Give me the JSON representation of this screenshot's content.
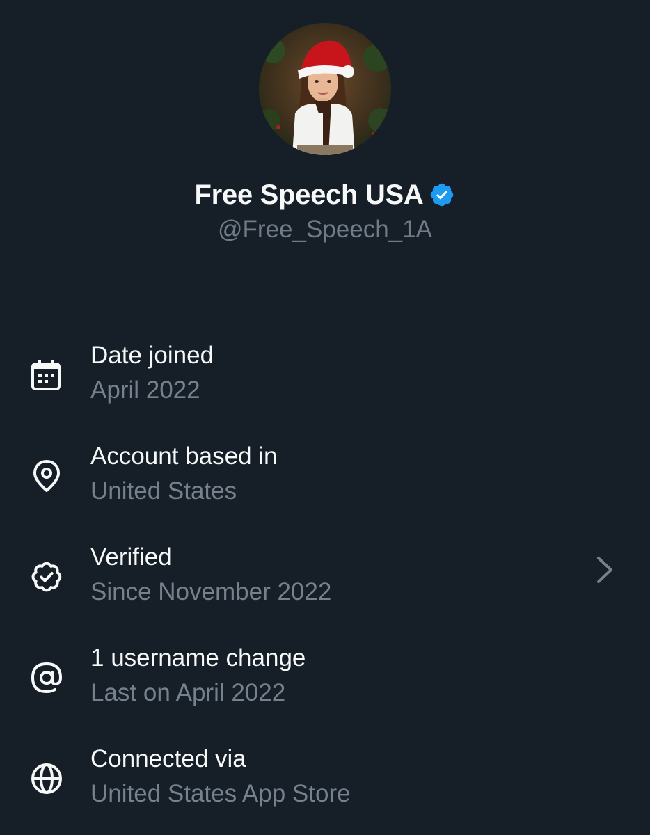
{
  "profile": {
    "display_name": "Free Speech USA",
    "handle": "@Free_Speech_1A",
    "verified": true,
    "badge_color": "#1d9bf0"
  },
  "about": {
    "items": [
      {
        "icon": "calendar-icon",
        "title": "Date joined",
        "subtitle": "April 2022",
        "has_chevron": false
      },
      {
        "icon": "location-pin-icon",
        "title": "Account based in",
        "subtitle": "United States",
        "has_chevron": false
      },
      {
        "icon": "verified-badge-outline-icon",
        "title": "Verified",
        "subtitle": "Since November 2022",
        "has_chevron": true
      },
      {
        "icon": "at-sign-icon",
        "title": "1 username change",
        "subtitle": "Last on April 2022",
        "has_chevron": false
      },
      {
        "icon": "globe-icon",
        "title": "Connected via",
        "subtitle": "United States App Store",
        "has_chevron": false
      }
    ]
  },
  "colors": {
    "background": "#161e28",
    "primary_text": "#f7f9f9",
    "secondary_text": "#75828e",
    "accent": "#1d9bf0"
  }
}
